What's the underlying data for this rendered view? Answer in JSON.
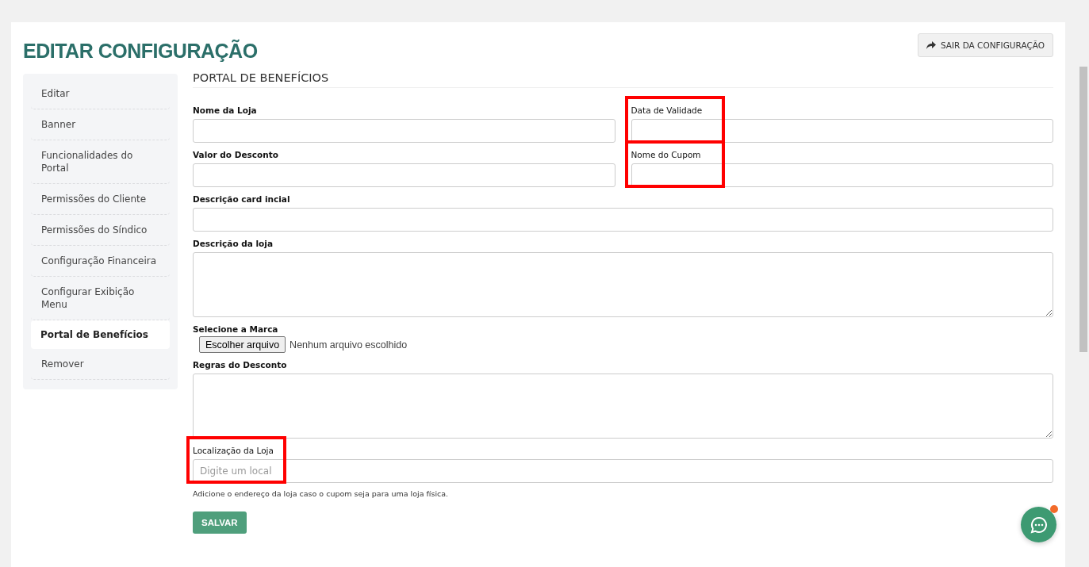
{
  "page_title": "EDITAR CONFIGURAÇÃO",
  "exit_button": {
    "label": "SAIR DA CONFIGURAÇÃO"
  },
  "sidebar": {
    "items": [
      {
        "label": "Editar",
        "selected": false
      },
      {
        "label": "Banner",
        "selected": false
      },
      {
        "label": "Funcionalidades do Portal",
        "selected": false
      },
      {
        "label": "Permissões do Cliente",
        "selected": false
      },
      {
        "label": "Permissões do Síndico",
        "selected": false
      },
      {
        "label": "Configuração Financeira",
        "selected": false
      },
      {
        "label": "Configurar Exibição Menu",
        "selected": false
      },
      {
        "label": "Portal de Benefícios",
        "selected": true
      },
      {
        "label": "Remover",
        "selected": false
      }
    ]
  },
  "section_title": "PORTAL DE BENEFÍCIOS",
  "form": {
    "rows": [
      [
        {
          "kind": "text",
          "label": "Nome da Loja",
          "label_bold": true,
          "highlighted": false
        },
        {
          "kind": "text",
          "label": "Data de Validade",
          "label_bold": false,
          "highlighted": true
        }
      ],
      [
        {
          "kind": "text",
          "label": "Valor do Desconto",
          "label_bold": true,
          "highlighted": false
        },
        {
          "kind": "text",
          "label": "Nome do Cupom",
          "label_bold": false,
          "highlighted": true
        }
      ],
      [
        {
          "kind": "text",
          "label": "Descrição card incial",
          "label_bold": true,
          "highlighted": false
        }
      ],
      [
        {
          "kind": "textarea",
          "label": "Descrição da loja",
          "label_bold": true,
          "highlighted": false
        }
      ],
      [
        {
          "kind": "file",
          "label": "Selecione a Marca",
          "label_bold": true,
          "highlighted": false,
          "button": "Escolher arquivo",
          "status": "Nenhum arquivo escolhido"
        }
      ],
      [
        {
          "kind": "textarea",
          "label": "Regras do Desconto",
          "label_bold": true,
          "highlighted": false
        }
      ],
      [
        {
          "kind": "text",
          "label": "Localização da Loja",
          "label_bold": false,
          "highlighted": true,
          "placeholder": "Digite um local",
          "help": "Adicione o endereço da loja caso o cupom seja para uma loja física."
        }
      ]
    ],
    "submit": "SALVAR"
  },
  "chat_button": {
    "notification": true
  }
}
